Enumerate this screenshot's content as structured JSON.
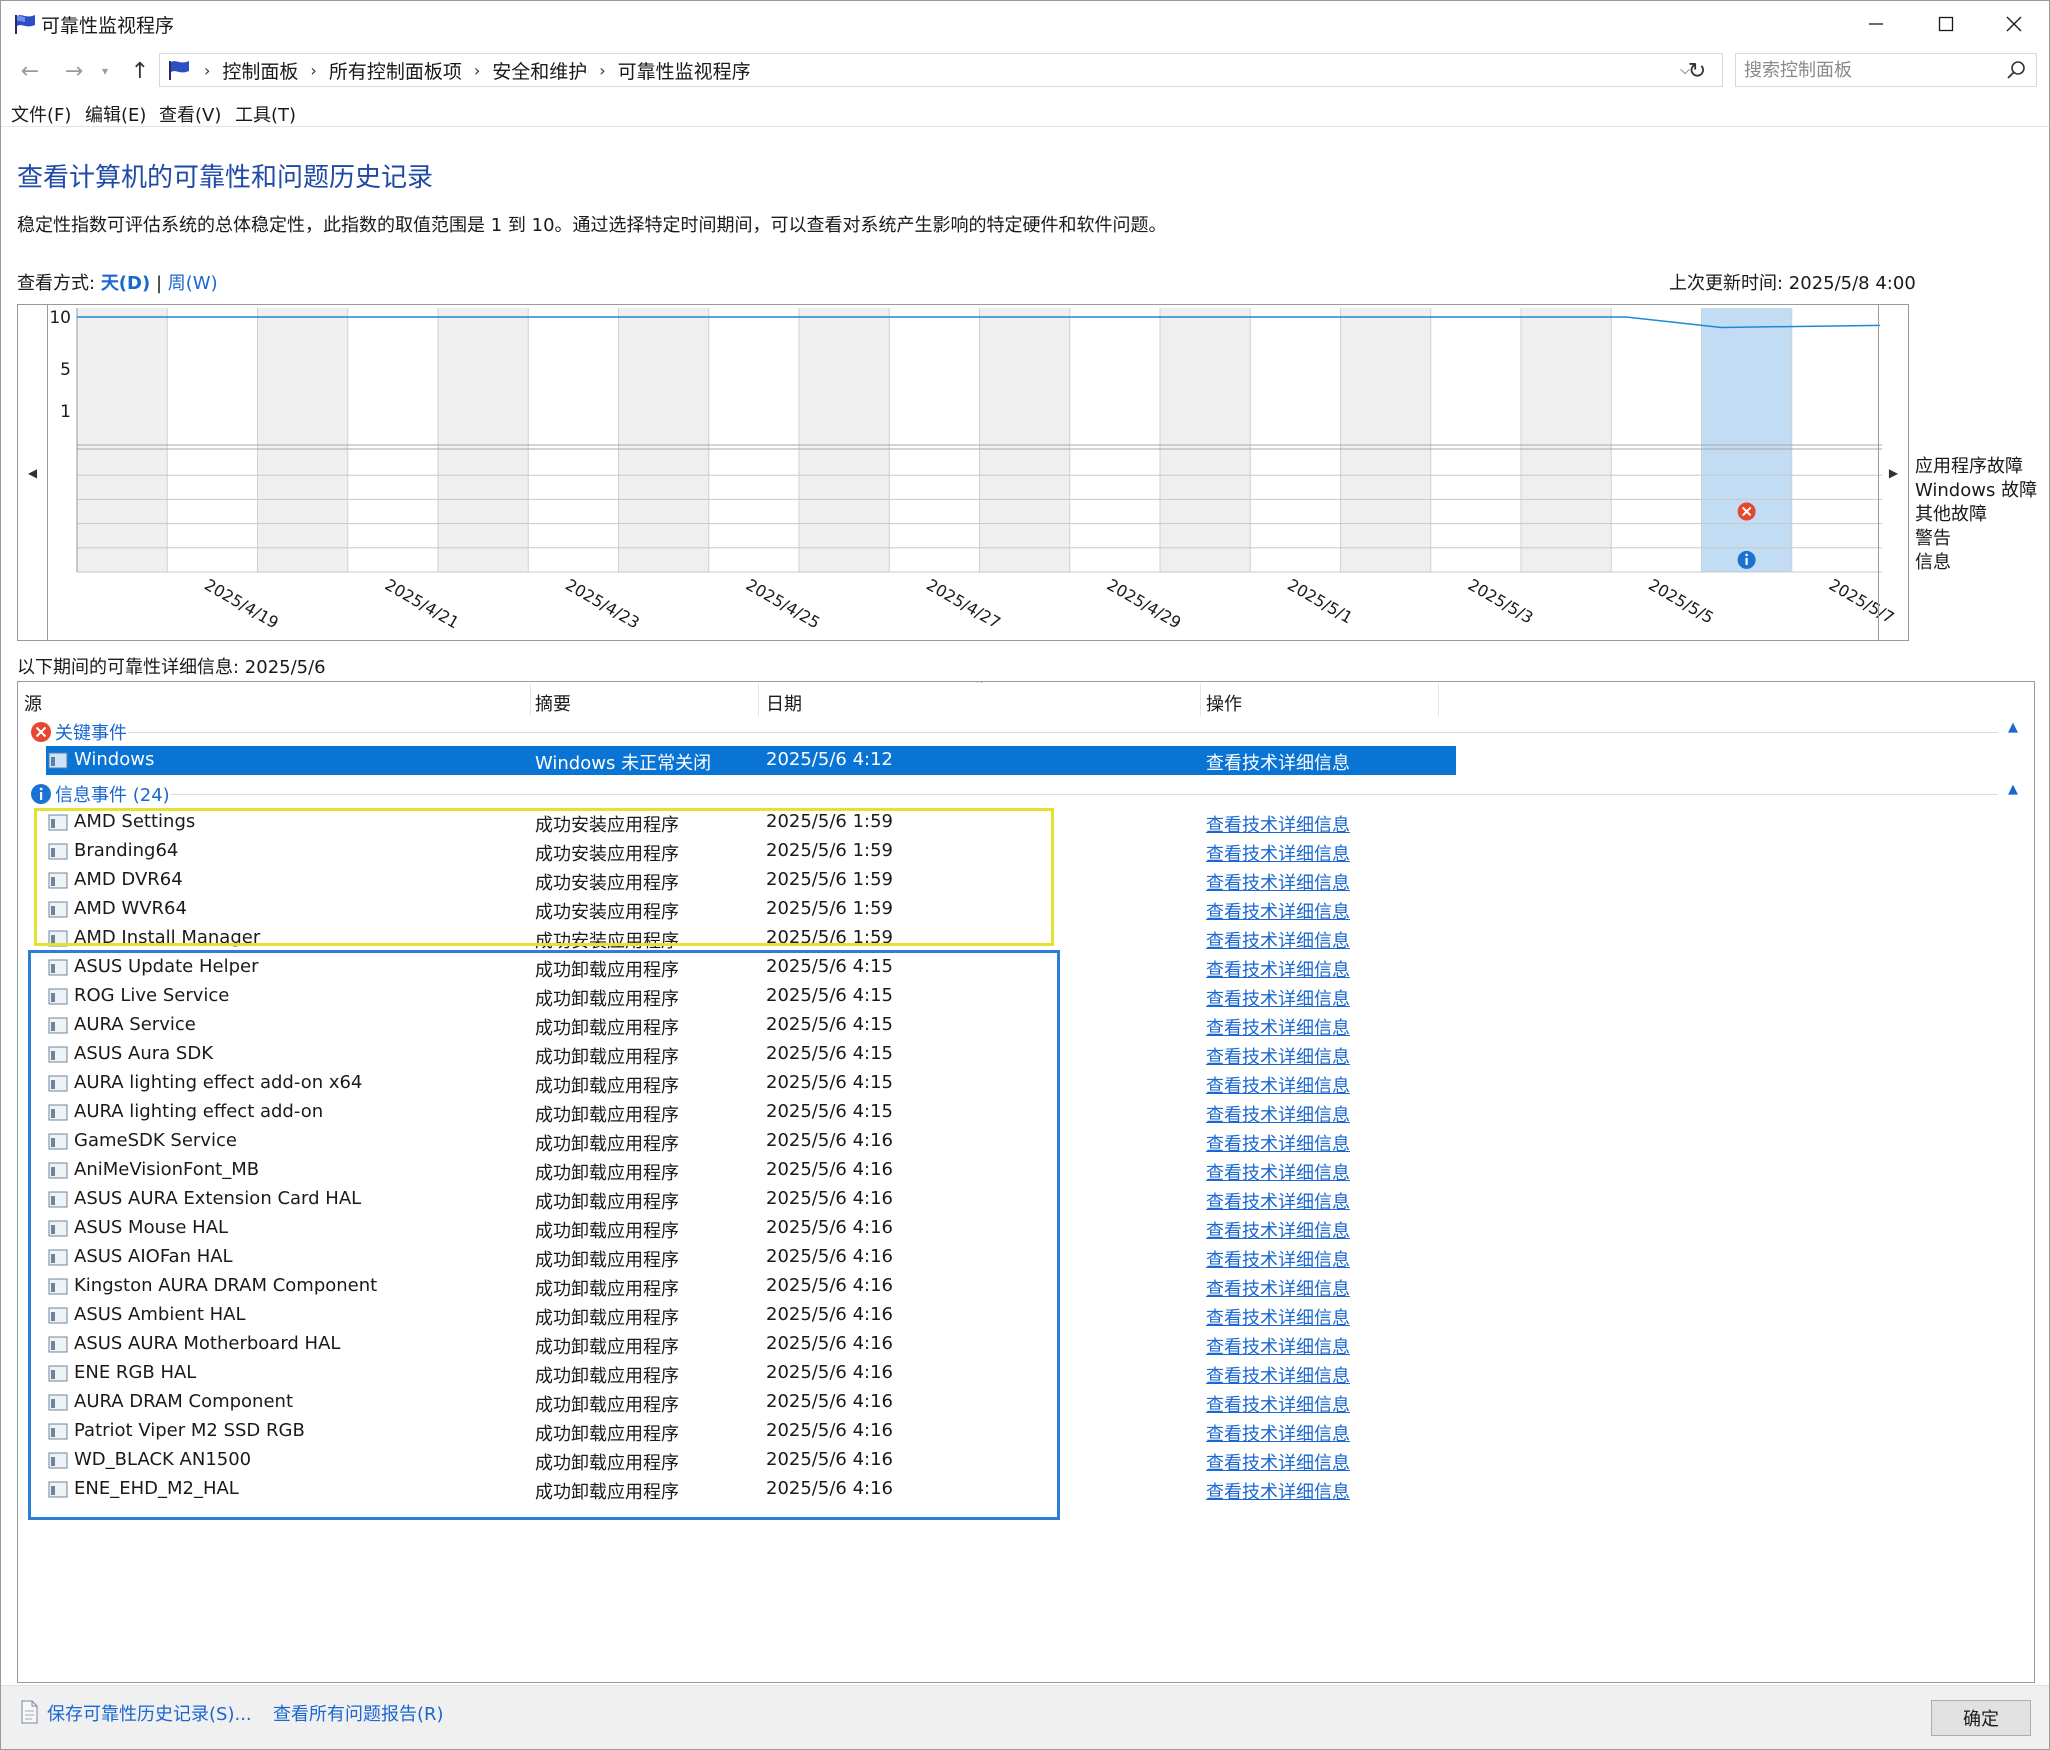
{
  "window": {
    "title": "可靠性监视程序"
  },
  "address": {
    "crumbs": [
      "控制面板",
      "所有控制面板项",
      "安全和维护",
      "可靠性监视程序"
    ],
    "search_placeholder": "搜索控制面板"
  },
  "menu": [
    "文件(F)",
    "编辑(E)",
    "查看(V)",
    "工具(T)"
  ],
  "page": {
    "title": "查看计算机的可靠性和问题历史记录",
    "description": "稳定性指数可评估系统的总体稳定性，此指数的取值范围是 1 到 10。通过选择特定时间期间，可以查看对系统产生影响的特定硬件和软件问题。",
    "view_by_label": "查看方式:",
    "view_day": "天(D)",
    "view_sep": "|",
    "view_week": "周(W)",
    "last_update": "上次更新时间: 2025/5/8 4:00",
    "details_label": "以下期间的可靠性详细信息: 2025/5/6"
  },
  "chart_data": {
    "type": "line",
    "y_ticks": [
      "10",
      "5",
      "1"
    ],
    "ylim": [
      1,
      10
    ],
    "x_tick_labels": [
      "2025/4/19",
      "2025/4/21",
      "2025/4/23",
      "2025/4/25",
      "2025/4/27",
      "2025/4/29",
      "2025/5/1",
      "2025/5/3",
      "2025/5/5",
      "2025/5/7"
    ],
    "days": [
      "2025/4/18",
      "2025/4/19",
      "2025/4/20",
      "2025/4/21",
      "2025/4/22",
      "2025/4/23",
      "2025/4/24",
      "2025/4/25",
      "2025/4/26",
      "2025/4/27",
      "2025/4/28",
      "2025/4/29",
      "2025/4/30",
      "2025/5/1",
      "2025/5/2",
      "2025/5/3",
      "2025/5/4",
      "2025/5/5",
      "2025/5/6",
      "2025/5/7"
    ],
    "selected_day": "2025/5/6",
    "stability_line": [
      {
        "x": "2025/4/18",
        "y": 10
      },
      {
        "x": "2025/5/5",
        "y": 10
      },
      {
        "x": "2025/5/6",
        "y": 9.0
      },
      {
        "x": "2025/5/7",
        "y": 9.2
      }
    ],
    "event_rows": [
      "应用程序故障",
      "Windows 故障",
      "其他故障",
      "警告",
      "信息"
    ],
    "events": [
      {
        "day": "2025/5/6",
        "row": "其他故障",
        "icon": "error-icon"
      },
      {
        "day": "2025/5/6",
        "row": "信息",
        "icon": "info-icon"
      }
    ],
    "colors": {
      "line": "#1a8ad4",
      "selected": "#c2dcf4",
      "alt_col": "#efefef",
      "error": "#e8462d",
      "info": "#1a73d2"
    }
  },
  "table": {
    "columns": [
      "源",
      "摘要",
      "日期",
      "操作"
    ],
    "critical": {
      "label": "关键事件",
      "rows": [
        {
          "source": "Windows",
          "summary": "Windows 未正常关闭",
          "date": "2025/5/6 4:12",
          "action": "查看技术详细信息"
        }
      ]
    },
    "info": {
      "label": "信息事件 (24)",
      "rows": [
        {
          "source": "AMD Settings",
          "summary": "成功安装应用程序",
          "date": "2025/5/6 1:59",
          "action": "查看技术详细信息"
        },
        {
          "source": "Branding64",
          "summary": "成功安装应用程序",
          "date": "2025/5/6 1:59",
          "action": "查看技术详细信息"
        },
        {
          "source": "AMD DVR64",
          "summary": "成功安装应用程序",
          "date": "2025/5/6 1:59",
          "action": "查看技术详细信息"
        },
        {
          "source": "AMD WVR64",
          "summary": "成功安装应用程序",
          "date": "2025/5/6 1:59",
          "action": "查看技术详细信息"
        },
        {
          "source": "AMD Install Manager",
          "summary": "成功安装应用程序",
          "date": "2025/5/6 1:59",
          "action": "查看技术详细信息"
        },
        {
          "source": "ASUS Update Helper",
          "summary": "成功卸载应用程序",
          "date": "2025/5/6 4:15",
          "action": "查看技术详细信息"
        },
        {
          "source": "ROG Live Service",
          "summary": "成功卸载应用程序",
          "date": "2025/5/6 4:15",
          "action": "查看技术详细信息"
        },
        {
          "source": "AURA Service",
          "summary": "成功卸载应用程序",
          "date": "2025/5/6 4:15",
          "action": "查看技术详细信息"
        },
        {
          "source": "ASUS Aura SDK",
          "summary": "成功卸载应用程序",
          "date": "2025/5/6 4:15",
          "action": "查看技术详细信息"
        },
        {
          "source": "AURA lighting effect add-on x64",
          "summary": "成功卸载应用程序",
          "date": "2025/5/6 4:15",
          "action": "查看技术详细信息"
        },
        {
          "source": "AURA lighting effect add-on",
          "summary": "成功卸载应用程序",
          "date": "2025/5/6 4:15",
          "action": "查看技术详细信息"
        },
        {
          "source": "GameSDK Service",
          "summary": "成功卸载应用程序",
          "date": "2025/5/6 4:16",
          "action": "查看技术详细信息"
        },
        {
          "source": "AniMeVisionFont_MB",
          "summary": "成功卸载应用程序",
          "date": "2025/5/6 4:16",
          "action": "查看技术详细信息"
        },
        {
          "source": "ASUS AURA Extension Card HAL",
          "summary": "成功卸载应用程序",
          "date": "2025/5/6 4:16",
          "action": "查看技术详细信息"
        },
        {
          "source": "ASUS Mouse HAL",
          "summary": "成功卸载应用程序",
          "date": "2025/5/6 4:16",
          "action": "查看技术详细信息"
        },
        {
          "source": "ASUS AIOFan HAL",
          "summary": "成功卸载应用程序",
          "date": "2025/5/6 4:16",
          "action": "查看技术详细信息"
        },
        {
          "source": "Kingston AURA DRAM Component",
          "summary": "成功卸载应用程序",
          "date": "2025/5/6 4:16",
          "action": "查看技术详细信息"
        },
        {
          "source": "ASUS Ambient HAL",
          "summary": "成功卸载应用程序",
          "date": "2025/5/6 4:16",
          "action": "查看技术详细信息"
        },
        {
          "source": "ASUS AURA Motherboard HAL",
          "summary": "成功卸载应用程序",
          "date": "2025/5/6 4:16",
          "action": "查看技术详细信息"
        },
        {
          "source": "ENE RGB HAL",
          "summary": "成功卸载应用程序",
          "date": "2025/5/6 4:16",
          "action": "查看技术详细信息"
        },
        {
          "source": "AURA DRAM Component",
          "summary": "成功卸载应用程序",
          "date": "2025/5/6 4:16",
          "action": "查看技术详细信息"
        },
        {
          "source": "Patriot Viper M2 SSD RGB",
          "summary": "成功卸载应用程序",
          "date": "2025/5/6 4:16",
          "action": "查看技术详细信息"
        },
        {
          "source": "WD_BLACK AN1500",
          "summary": "成功卸载应用程序",
          "date": "2025/5/6 4:16",
          "action": "查看技术详细信息"
        },
        {
          "source": "ENE_EHD_M2_HAL",
          "summary": "成功卸载应用程序",
          "date": "2025/5/6 4:16",
          "action": "查看技术详细信息"
        }
      ]
    }
  },
  "footer": {
    "save_link": "保存可靠性历史记录(S)...",
    "report_link": "查看所有问题报告(R)",
    "ok_label": "确定"
  }
}
